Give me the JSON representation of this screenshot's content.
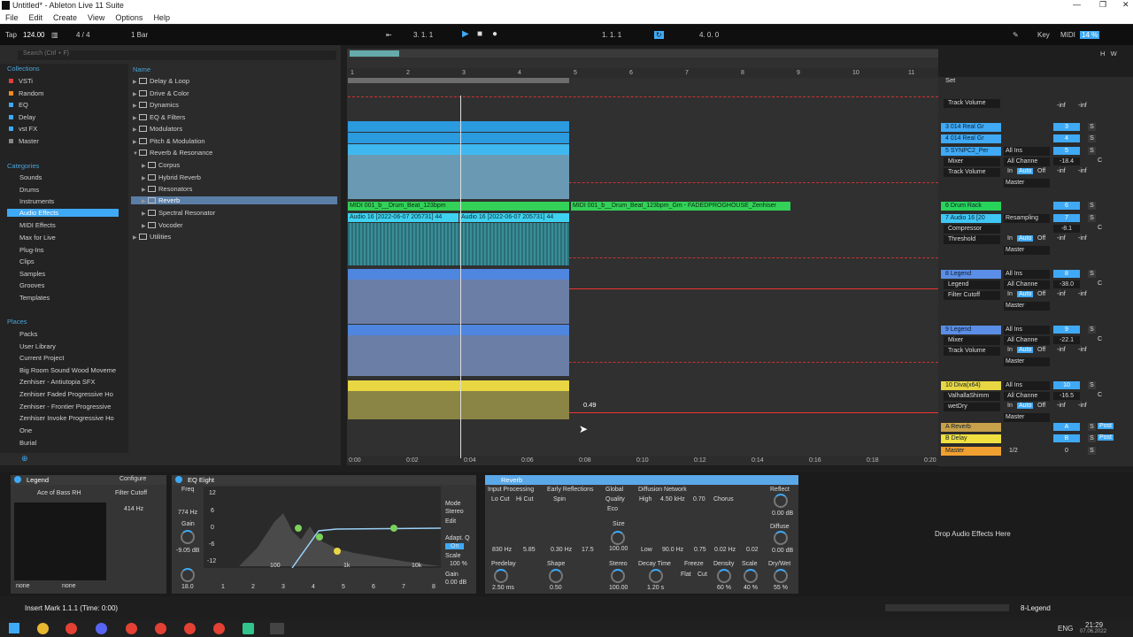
{
  "window": {
    "title": "Untitled* - Ableton Live 11 Suite"
  },
  "menu": [
    "File",
    "Edit",
    "Create",
    "View",
    "Options",
    "Help"
  ],
  "transport": {
    "tap": "Tap",
    "tempo": "124.00",
    "signature": "4 / 4",
    "quantize": "1 Bar",
    "position": "3.   1.   1",
    "loop_start": "1.   1.   1",
    "loop_length": "4.   0.   0",
    "key": "Key",
    "midi": "MIDI",
    "cpu": "14 %"
  },
  "browser": {
    "search_placeholder": "Search (Ctrl + F)",
    "collections_title": "Collections",
    "collections": [
      "VSTi",
      "Random",
      "EQ",
      "Delay",
      "vst FX",
      "Master"
    ],
    "collection_colors": [
      "#e0413b",
      "#f08a24",
      "#3fa9f5",
      "#3fa9f5",
      "#3fa9f5",
      "#888888"
    ],
    "categories_title": "Categories",
    "categories": [
      "Sounds",
      "Drums",
      "Instruments",
      "Audio Effects",
      "MIDI Effects",
      "Max for Live",
      "Plug-Ins",
      "Clips",
      "Samples",
      "Grooves",
      "Templates"
    ],
    "places_title": "Places",
    "places": [
      "Packs",
      "User Library",
      "Current Project",
      "Big Room Sound Wood Moveme",
      "Zenhiser - Antiutopia SFX",
      "Zenhiser Faded Progressive Ho",
      "Zenhiser - Frontier Progressive",
      "Zenhiser Invoke Progressive Ho",
      "One",
      "Burial"
    ],
    "name_header": "Name",
    "tree": [
      "Delay & Loop",
      "Drive & Color",
      "Dynamics",
      "EQ & Filters",
      "Modulators",
      "Pitch & Modulation",
      "Reverb & Resonance",
      "Corpus",
      "Hybrid Reverb",
      "Resonators",
      "Reverb",
      "Spectral Resonator",
      "Vocoder",
      "Utilities"
    ]
  },
  "arrangement": {
    "bar_ticks": [
      "1",
      "2",
      "3",
      "4",
      "5",
      "6",
      "7",
      "8",
      "9",
      "10",
      "11"
    ],
    "time_ticks": [
      "0:00",
      "0:02",
      "0:04",
      "0:06",
      "0:08",
      "0:10",
      "0:12",
      "0:14",
      "0:16",
      "0:18",
      "0:20"
    ],
    "clip_midi": "MIDI 001_b__Drum_Beat_123bpm_Gm - FADEDPROGHOUSE_Zenhiser",
    "clip_midi_short": "MIDI 001_b__Drum_Beat_123bpm",
    "clip_audio1": "Audio 16 [2022-06-07 205731] 44",
    "clip_audio2": "Audio 16 [2022-06-07 205731] 44",
    "value_label": "0.49"
  },
  "mixer": {
    "set_label": "Set",
    "tracks": [
      {
        "name": "Track Volume",
        "kind": "param"
      },
      {
        "name": "3 014 Real Gr",
        "color": "#3fa9f5",
        "num": "3"
      },
      {
        "name": "4 014 Real Gr",
        "color": "#3fa9f5",
        "num": "4"
      },
      {
        "name": "5 SYNPC2_Per",
        "color": "#3fa9f5",
        "num": "5",
        "io": "All Ins",
        "p1": "Mixer",
        "p2": "Track Volume",
        "ch": "All Channe",
        "vol": "-18.4",
        "out": "Master"
      },
      {
        "name": "6 Drum Rack",
        "color": "#28d35a",
        "num": "6"
      },
      {
        "name": "7 Audio 16 [20",
        "color": "#3fc6f5",
        "num": "7",
        "io": "Resampling",
        "p1": "Compressor",
        "p2": "Threshold",
        "vol": "-8.1",
        "out": "Master"
      },
      {
        "name": "8 Legend",
        "color": "#5b8ee6",
        "num": "8",
        "io": "All Ins",
        "p1": "Legend",
        "p2": "Filter Cutoff",
        "ch": "All Channe",
        "vol": "-38.0",
        "out": "Master"
      },
      {
        "name": "9 Legend",
        "color": "#5b8ee6",
        "num": "9",
        "io": "All Ins",
        "p1": "Mixer",
        "p2": "Track Volume",
        "ch": "All Channe",
        "vol": "-22.1",
        "out": "Master"
      },
      {
        "name": "10 Diva(x64)",
        "color": "#e8d743",
        "num": "10",
        "io": "All Ins",
        "p1": "ValhallaShimm",
        "p2": "wetDry",
        "ch": "All Channe",
        "vol": "-16.5",
        "out": "Master"
      },
      {
        "name": "A Reverb",
        "color": "#c8a24a",
        "num": "A"
      },
      {
        "name": "B Delay",
        "color": "#f0e040",
        "num": "B"
      },
      {
        "name": "Master",
        "color": "#f0a030",
        "num": ""
      }
    ],
    "inf": "-inf",
    "c": "C",
    "s": "S",
    "post": "Post",
    "in": "In",
    "auto": "Auto",
    "off": "Off",
    "master_ratio": "1/2",
    "zero": "0"
  },
  "devices": {
    "legend": {
      "title": "Legend",
      "configure": "Configure",
      "preset": "Ace of Bass RH",
      "param": "Filter Cutoff",
      "value": "414 Hz",
      "none1": "none",
      "none2": "none"
    },
    "eq": {
      "title": "EQ Eight",
      "freq_label": "Freq",
      "freq": "774 Hz",
      "gain_label": "Gain",
      "gain": "-9.05 dB",
      "q": "18.0",
      "mode_label": "Mode",
      "mode": "Stereo",
      "edit": "Edit",
      "adapt": "Adapt. Q",
      "on": "On",
      "scale_label": "Scale",
      "scale": "100 %",
      "out_gain_label": "Gain",
      "out_gain": "0.00 dB",
      "y_ticks": [
        "12",
        "6",
        "0",
        "-6",
        "-12"
      ],
      "x_ticks": [
        "100",
        "1k",
        "10k"
      ],
      "bands": [
        "1",
        "2",
        "3",
        "4",
        "5",
        "6",
        "7",
        "8"
      ]
    },
    "reverb": {
      "title": "Reverb",
      "input": "Input Processing",
      "locut": "Lo Cut",
      "hicut": "Hi Cut",
      "early": "Early Reflections",
      "spin": "Spin",
      "global": "Global",
      "quality": "Quality",
      "eco": "Eco",
      "diffusion": "Diffusion Network",
      "high": "High",
      "high_val": "4.50 kHz",
      "high_r": "0.70",
      "chorus": "Chorus",
      "reflect": "Reflect",
      "reflect_val": "0.00 dB",
      "diffuse": "Diffuse",
      "diffuse_val": "0.00 dB",
      "size": "Size",
      "size_val": "100.00",
      "lo_val": "830 Hz",
      "lo_r": "5.85",
      "spin_val": "0.30 Hz",
      "spin_r": "17.5",
      "low": "Low",
      "low_val": "90.0 Hz",
      "low_r": "0.75",
      "mid1": "0.02 Hz",
      "mid2": "0.02",
      "predelay": "Predelay",
      "predelay_val": "2.50 ms",
      "shape": "Shape",
      "shape_val": "0.50",
      "stereo": "Stereo",
      "stereo_val": "100.00",
      "decay": "Decay Time",
      "decay_val": "1.20 s",
      "freeze": "Freeze",
      "flat": "Flat",
      "cut": "Cut",
      "density": "Density",
      "density_val": "60 %",
      "scale": "Scale",
      "scale_val": "40 %",
      "drywet": "Dry/Wet",
      "drywet_val": "55 %"
    },
    "drop_hint": "Drop Audio Effects Here"
  },
  "status": {
    "text": "Insert Mark 1.1.1 (Time: 0:00)",
    "track": "8-Legend"
  },
  "taskbar": {
    "lang": "ENG",
    "time": "21:29",
    "date": "07.06.2022"
  }
}
